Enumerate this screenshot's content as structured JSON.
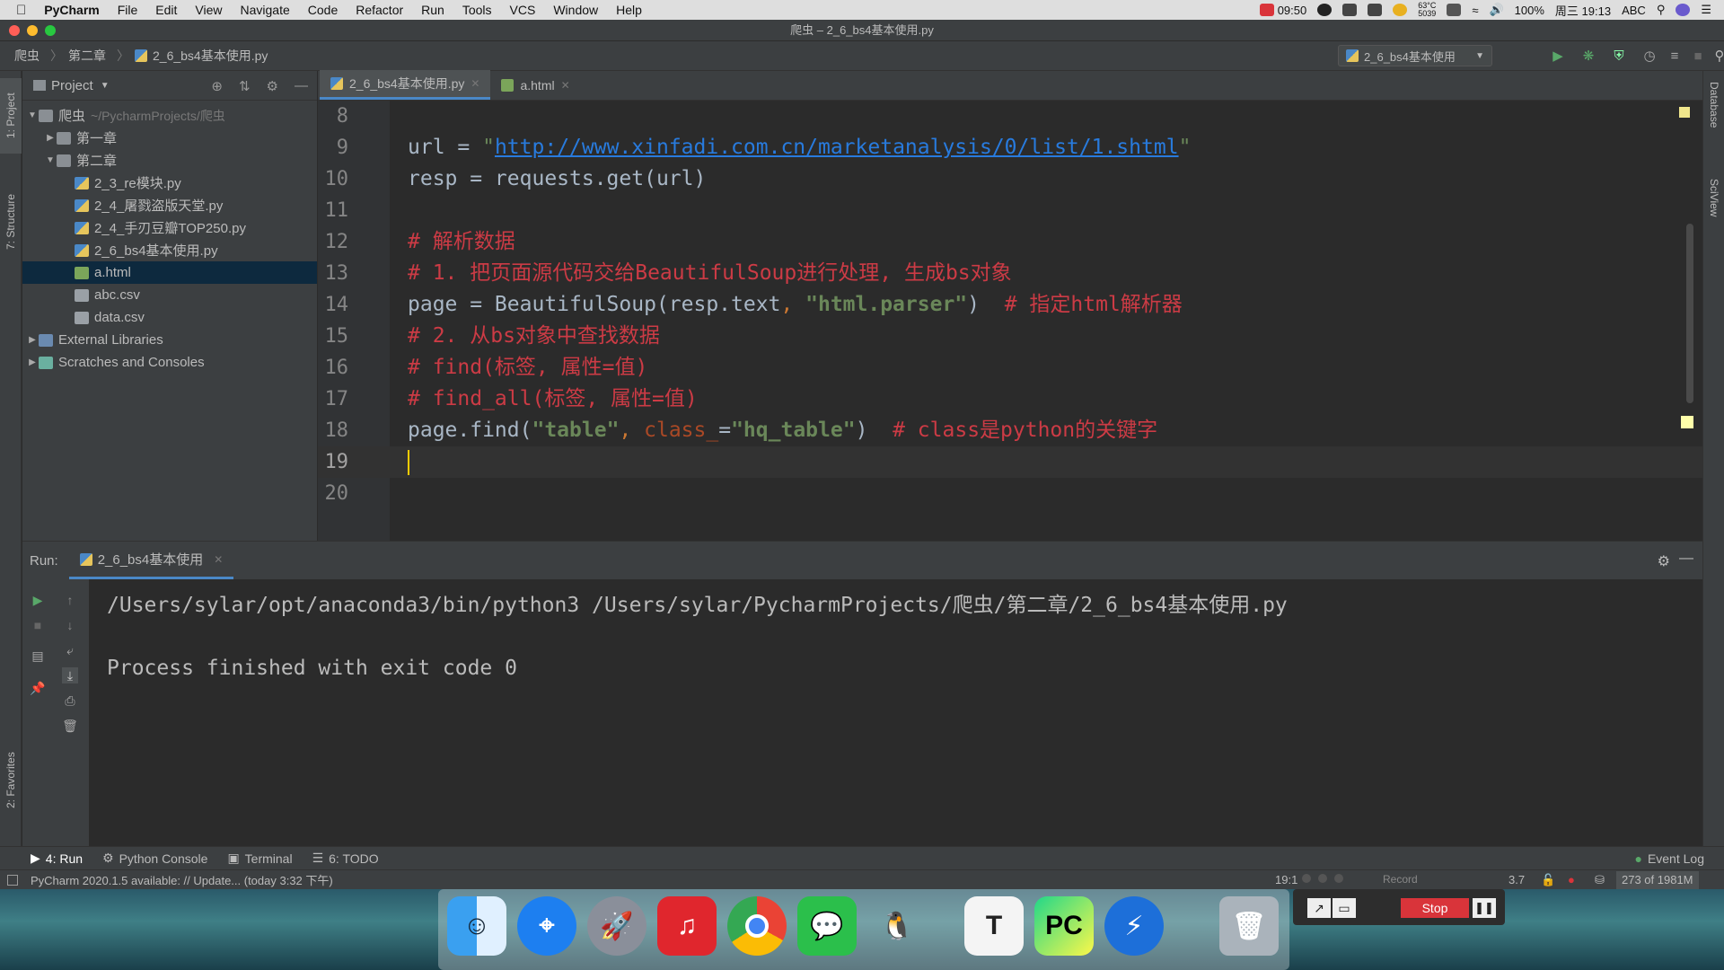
{
  "menubar": {
    "app_name": "PyCharm",
    "items": [
      "File",
      "Edit",
      "View",
      "Navigate",
      "Code",
      "Refactor",
      "Run",
      "Tools",
      "VCS",
      "Window",
      "Help"
    ],
    "tray": {
      "timer": "09:50",
      "temp": "63°C",
      "temp2": "5039",
      "battery": "100%",
      "datetime": "周三 19:13",
      "input_method": "ABC"
    }
  },
  "window": {
    "title": "爬虫 – 2_6_bs4基本使用.py"
  },
  "breadcrumb": {
    "items": [
      "爬虫",
      "第二章",
      "2_6_bs4基本使用.py"
    ]
  },
  "run_config": {
    "label": "2_6_bs4基本使用"
  },
  "side_tabs": {
    "project": "1: Project",
    "structure": "7: Structure",
    "favorites": "2: Favorites",
    "database": "Database",
    "sciview": "SciView"
  },
  "project_panel": {
    "title": "Project",
    "tree": [
      {
        "label": "爬虫",
        "path": "~/PycharmProjects/爬虫",
        "type": "folder",
        "indent": 0,
        "arrow": "▼"
      },
      {
        "label": "第一章",
        "path": "",
        "type": "folder",
        "indent": 1,
        "arrow": "▶"
      },
      {
        "label": "第二章",
        "path": "",
        "type": "folder",
        "indent": 1,
        "arrow": "▼"
      },
      {
        "label": "2_3_re模块.py",
        "path": "",
        "type": "py",
        "indent": 2,
        "arrow": ""
      },
      {
        "label": "2_4_屠戮盗版天堂.py",
        "path": "",
        "type": "py",
        "indent": 2,
        "arrow": ""
      },
      {
        "label": "2_4_手刃豆瓣TOP250.py",
        "path": "",
        "type": "py",
        "indent": 2,
        "arrow": ""
      },
      {
        "label": "2_6_bs4基本使用.py",
        "path": "",
        "type": "py",
        "indent": 2,
        "arrow": ""
      },
      {
        "label": "a.html",
        "path": "",
        "type": "html",
        "indent": 2,
        "arrow": "",
        "selected": true
      },
      {
        "label": "abc.csv",
        "path": "",
        "type": "csv",
        "indent": 2,
        "arrow": ""
      },
      {
        "label": "data.csv",
        "path": "",
        "type": "csv",
        "indent": 2,
        "arrow": ""
      },
      {
        "label": "External Libraries",
        "path": "",
        "type": "lib",
        "indent": 0,
        "arrow": "▶"
      },
      {
        "label": "Scratches and Consoles",
        "path": "",
        "type": "scratch",
        "indent": 0,
        "arrow": "▶"
      }
    ]
  },
  "editor": {
    "tabs": [
      {
        "label": "2_6_bs4基本使用.py",
        "active": true
      },
      {
        "label": "a.html",
        "active": false
      }
    ],
    "lines": [
      {
        "num": "8",
        "segs": []
      },
      {
        "num": "9",
        "segs": [
          {
            "t": "url = ",
            "c": ""
          },
          {
            "t": "\"",
            "c": "str"
          },
          {
            "t": "http://www.xinfadi.com.cn/marketanalysis/0/list/1.shtml",
            "c": "url"
          },
          {
            "t": "\"",
            "c": "str"
          }
        ]
      },
      {
        "num": "10",
        "segs": [
          {
            "t": "resp = requests.get(url)",
            "c": ""
          }
        ]
      },
      {
        "num": "11",
        "segs": []
      },
      {
        "num": "12",
        "segs": [
          {
            "t": "# 解析数据",
            "c": "cmt"
          }
        ]
      },
      {
        "num": "13",
        "segs": [
          {
            "t": "# 1. 把页面源代码交给BeautifulSoup进行处理, 生成bs对象",
            "c": "cmt"
          }
        ]
      },
      {
        "num": "14",
        "segs": [
          {
            "t": "page = BeautifulSoup(resp.text",
            "c": ""
          },
          {
            "t": ", ",
            "c": "kw"
          },
          {
            "t": "\"html.parser\"",
            "c": "strb"
          },
          {
            "t": ")  ",
            "c": ""
          },
          {
            "t": "# 指定html解析器",
            "c": "cmt"
          }
        ]
      },
      {
        "num": "15",
        "segs": [
          {
            "t": "# 2. 从bs对象中查找数据",
            "c": "cmt"
          }
        ]
      },
      {
        "num": "16",
        "segs": [
          {
            "t": "# find(标签, 属性=值)",
            "c": "cmt"
          }
        ]
      },
      {
        "num": "17",
        "segs": [
          {
            "t": "# find_all(标签, 属性=值)",
            "c": "cmt"
          }
        ]
      },
      {
        "num": "18",
        "segs": [
          {
            "t": "page.find(",
            "c": ""
          },
          {
            "t": "\"table\"",
            "c": "strb"
          },
          {
            "t": ", ",
            "c": "kw"
          },
          {
            "t": "class_",
            "c": "param"
          },
          {
            "t": "=",
            "c": ""
          },
          {
            "t": "\"hq_table\"",
            "c": "strb"
          },
          {
            "t": ")  ",
            "c": ""
          },
          {
            "t": "# class是python的关键字",
            "c": "cmt"
          }
        ]
      },
      {
        "num": "19",
        "segs": [],
        "current": true
      },
      {
        "num": "20",
        "segs": []
      }
    ]
  },
  "run_panel": {
    "label": "Run:",
    "tab": "2_6_bs4基本使用",
    "console": [
      "/Users/sylar/opt/anaconda3/bin/python3 /Users/sylar/PycharmProjects/爬虫/第二章/2_6_bs4基本使用.py",
      "",
      "Process finished with exit code 0"
    ]
  },
  "bottom_tabs": [
    "4: Run",
    "Python Console",
    "Terminal",
    "6: TODO"
  ],
  "event_log": "Event Log",
  "status": {
    "message": "PyCharm 2020.1.5 available: // Update... (today 3:32 下午)",
    "position": "19:1",
    "version": "3.7",
    "memory": "273 of 1981M"
  },
  "recorder": {
    "record_label": "Record",
    "stop_label": "Stop"
  },
  "dock": [
    "Finder",
    "Safari",
    "Launchpad",
    "NetEase Music",
    "Chrome",
    "WeChat",
    "QQ",
    "Typora",
    "PyCharm",
    "Thunder",
    "Trash"
  ],
  "colors": {
    "editor_bg": "#2b2b2b",
    "panel_bg": "#3c3f41",
    "comment": "#cc3b45",
    "string": "#6a8759",
    "keyword": "#cc7832",
    "link": "#287bde",
    "caret": "#ffcc00"
  }
}
